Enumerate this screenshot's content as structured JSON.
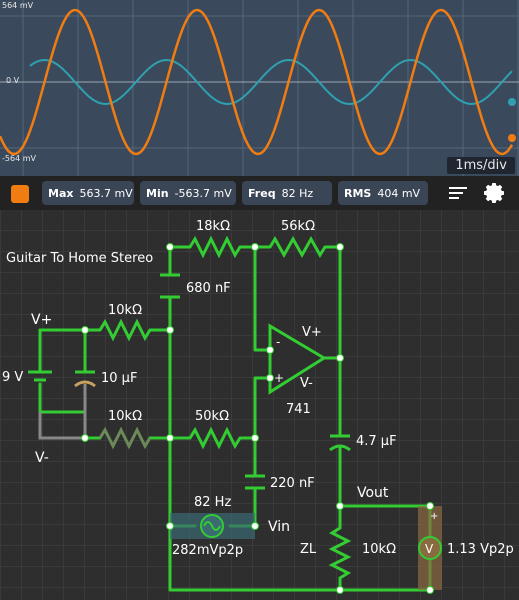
{
  "scope": {
    "y_max_label": "564 mV",
    "y_zero_label": "0 V",
    "y_min_label": "-564 mV",
    "time_div": "1ms/div",
    "trace_colors": {
      "output": "#f07c12",
      "input": "#2fa0b0"
    }
  },
  "toolbar": {
    "swatch_color": "#f07c12",
    "max_label": "Max",
    "max_value": "563.7 mV",
    "min_label": "Min",
    "min_value": "-563.7 mV",
    "freq_label": "Freq",
    "freq_value": "82 Hz",
    "rms_label": "RMS",
    "rms_value": "404 mV",
    "menu_icon": "menu-lines-icon",
    "settings_icon": "gear-icon"
  },
  "circuit": {
    "title": "Guitar To Home Stereo",
    "r_18k": "18kΩ",
    "r_56k": "56kΩ",
    "c_680n": "680 nF",
    "vplus_label": "V+",
    "r_10k_top": "10kΩ",
    "battery_label": "9 V",
    "c_10u": "10 µF",
    "vminus_label": "V-",
    "r_10k_bottom": "10kΩ",
    "r_50k": "50kΩ",
    "opamp_minus": "-",
    "opamp_plus": "+",
    "opamp_vplus": "V+",
    "opamp_vminus": "V-",
    "opamp_model": "741",
    "c_4_7u": "4.7 µF",
    "c_220n": "220 nF",
    "vout_label": "Vout",
    "source_freq": "82 Hz",
    "vin_label": "Vin",
    "source_amp": "282mVp2p",
    "zl_label": "ZL",
    "r_10k_load": "10kΩ",
    "meter_value": "1.13 Vp2p",
    "meter_symbol": "V",
    "meter_plus": "+",
    "wire_color": "#33cc33"
  }
}
